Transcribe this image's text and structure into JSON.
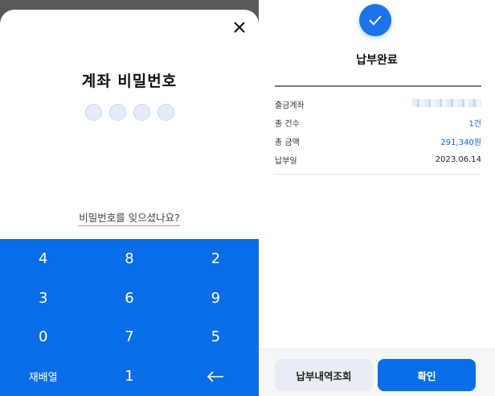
{
  "password_screen": {
    "title": "계좌 비밀번호",
    "forgot_link": "비밀번호를 잊으셨나요?",
    "pin_length": 4,
    "keys": [
      "4",
      "8",
      "2",
      "3",
      "6",
      "9",
      "0",
      "7",
      "5",
      "재배열",
      "1",
      "←"
    ]
  },
  "result_screen": {
    "title": "납부완료",
    "rows": [
      {
        "label": "출금계좌",
        "value": ""
      },
      {
        "label": "총 건수",
        "value": "1건"
      },
      {
        "label": "총 금액",
        "value": "291,340원"
      },
      {
        "label": "납부일",
        "value": "2023.06.14"
      }
    ],
    "history_button": "납부내역조회",
    "confirm_button": "확인"
  },
  "colors": {
    "accent": "#0a6de8",
    "check_circle": "#1a73e8",
    "link_blue": "#1a5fd6",
    "dim_overlay": "#5a5a5a"
  }
}
